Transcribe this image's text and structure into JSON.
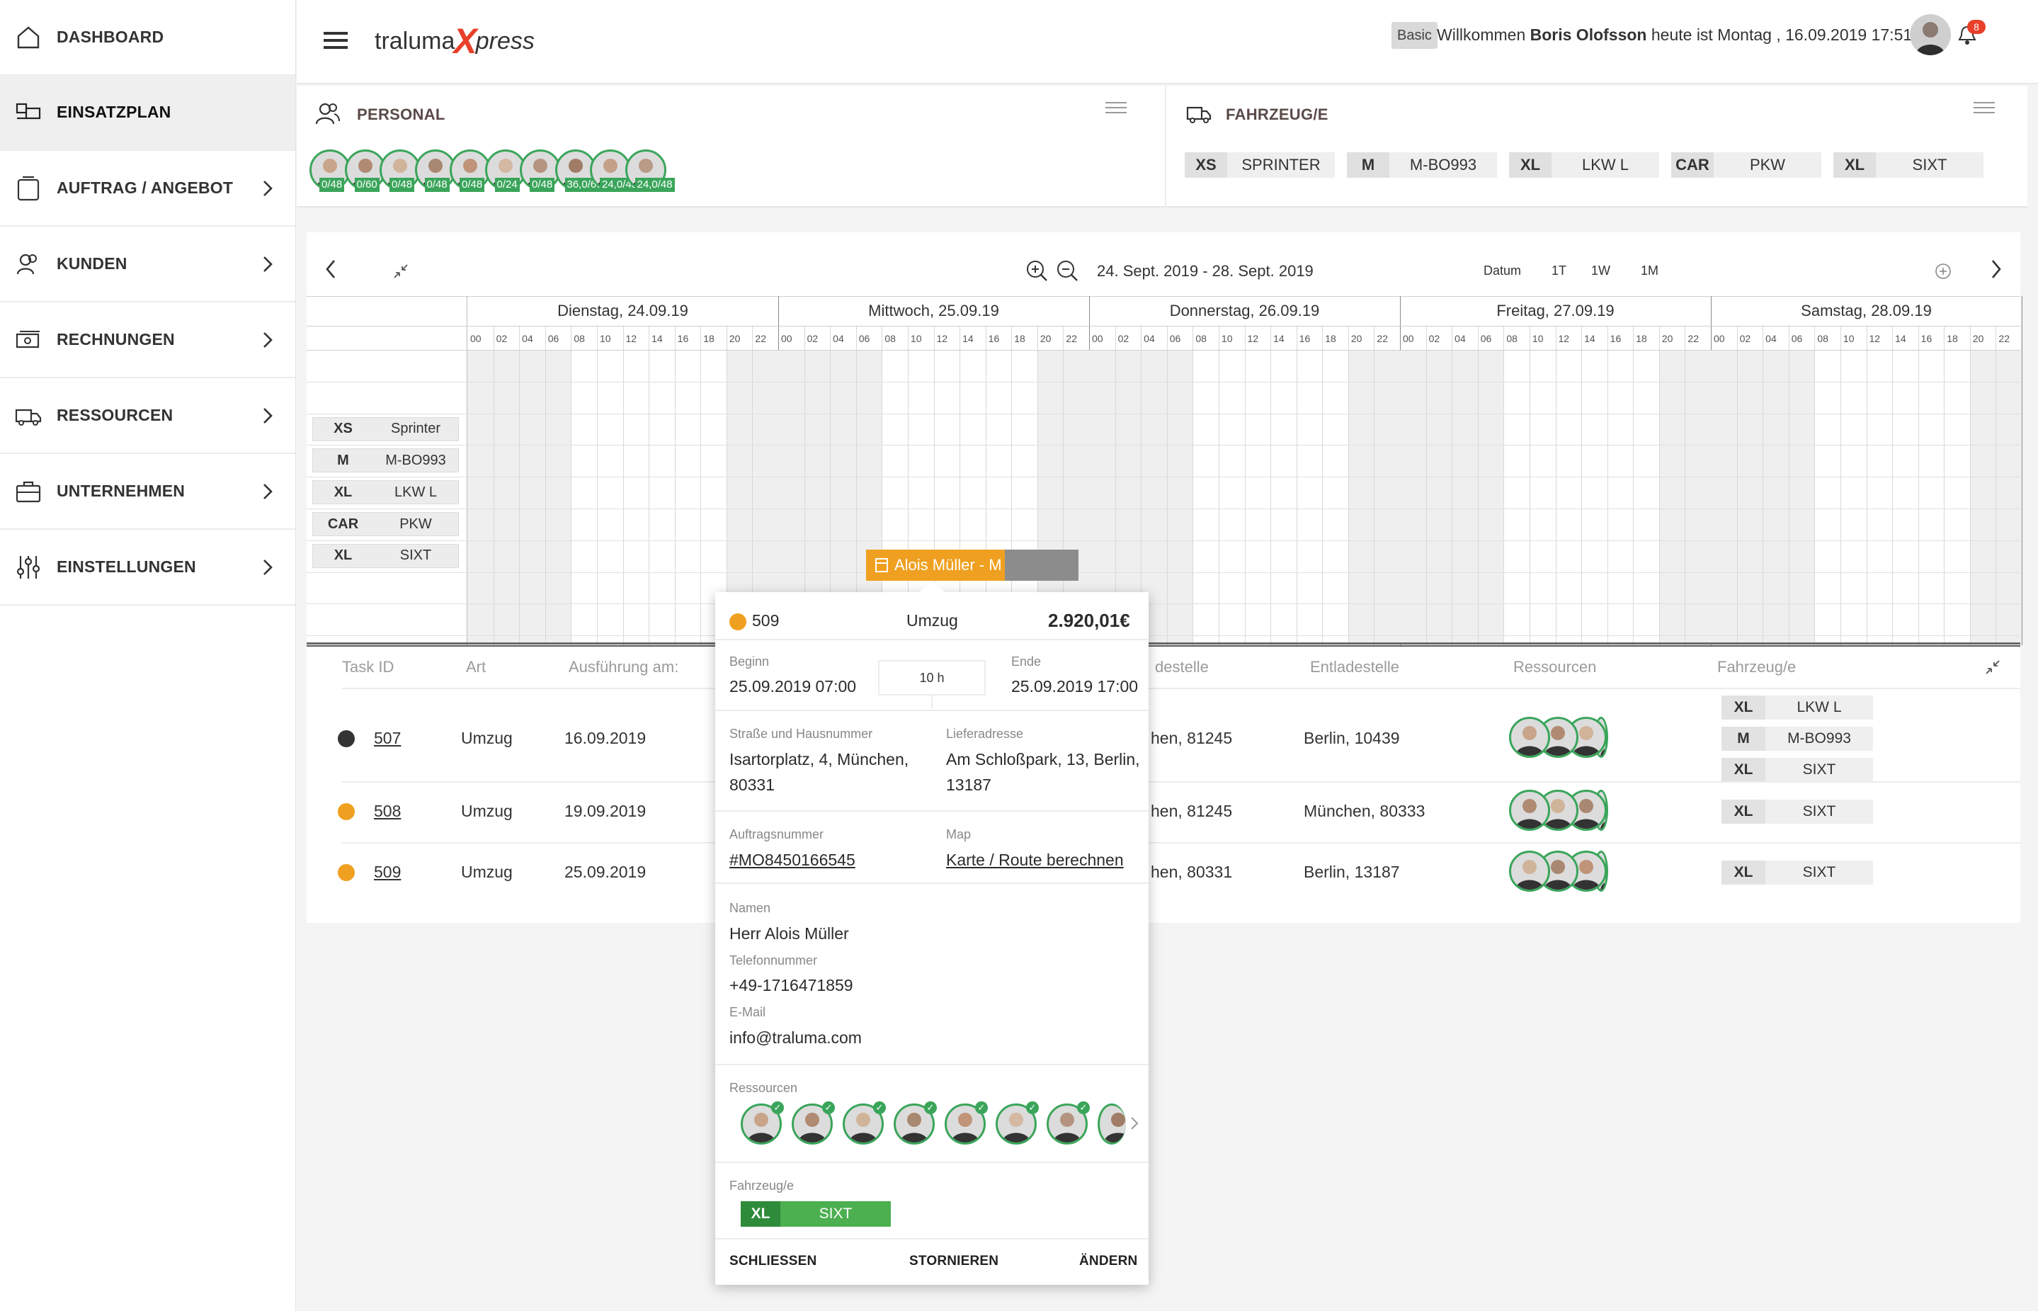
{
  "sidebar": {
    "items": [
      {
        "label": "DASHBOARD",
        "icon": "home-icon"
      },
      {
        "label": "EINSATZPLAN",
        "icon": "schedule-icon"
      },
      {
        "label": "AUFTRAG / ANGEBOT",
        "icon": "order-icon"
      },
      {
        "label": "KUNDEN",
        "icon": "customers-icon"
      },
      {
        "label": "RECHNUNGEN",
        "icon": "invoice-icon"
      },
      {
        "label": "RESSOURCEN",
        "icon": "truck-icon"
      },
      {
        "label": "UNTERNEHMEN",
        "icon": "briefcase-icon"
      },
      {
        "label": "EINSTELLUNGEN",
        "icon": "sliders-icon"
      }
    ]
  },
  "header": {
    "logo_a": "traluma",
    "logo_x": "X",
    "logo_b": "press",
    "plan_badge": "Basic",
    "welcome_pre": "Willkommen ",
    "user_name": "Boris Olofsson",
    "welcome_post": " heute ist Montag , 16.09.2019 17:51",
    "notification_count": "8"
  },
  "personal": {
    "title": "PERSONAL",
    "staff": [
      {
        "badge": "0/48"
      },
      {
        "badge": "0/60"
      },
      {
        "badge": "0/48"
      },
      {
        "badge": "0/48"
      },
      {
        "badge": "0/48"
      },
      {
        "badge": "0/24"
      },
      {
        "badge": "0/48"
      },
      {
        "badge": "36,0/60"
      },
      {
        "badge": "24,0/48"
      },
      {
        "badge": "24,0/48"
      }
    ]
  },
  "fahrzeuge": {
    "title": "FAHRZEUG/E",
    "items": [
      {
        "cls": "XS",
        "name": "SPRINTER"
      },
      {
        "cls": "M",
        "name": "M-BO993"
      },
      {
        "cls": "XL",
        "name": "LKW L"
      },
      {
        "cls": "CAR",
        "name": "PKW"
      },
      {
        "cls": "XL",
        "name": "SIXT"
      }
    ]
  },
  "calendar": {
    "range": "24. Sept. 2019 - 28. Sept. 2019",
    "view_label": "Datum",
    "views": [
      "1T",
      "1W",
      "1M"
    ],
    "days": [
      "Dienstag, 24.09.19",
      "Mittwoch, 25.09.19",
      "Donnerstag, 26.09.19",
      "Freitag, 27.09.19",
      "Samstag, 28.09.19"
    ],
    "hours": [
      "00",
      "02",
      "04",
      "06",
      "08",
      "10",
      "12",
      "14",
      "16",
      "18",
      "20",
      "22"
    ],
    "rows": [
      {
        "cls": "XS",
        "name": "Sprinter"
      },
      {
        "cls": "M",
        "name": "M-BO993"
      },
      {
        "cls": "XL",
        "name": "LKW L"
      },
      {
        "cls": "CAR",
        "name": "PKW"
      },
      {
        "cls": "XL",
        "name": "SIXT"
      }
    ],
    "event_label": "Alois Müller - M",
    "colors": {
      "event": "#f0a020",
      "accent": "#e8402a",
      "green": "#3aa55a"
    }
  },
  "table": {
    "headers": [
      "Task ID",
      "Art",
      "Ausführung am:",
      "destelle",
      "Entladestelle",
      "Ressourcen",
      "Fahrzeug/e"
    ],
    "rows": [
      {
        "status": "#333333",
        "id": "507",
        "art": "Umzug",
        "date": "16.09.2019",
        "from": "hen, 81245",
        "to": "Berlin, 10439",
        "vehicles": [
          {
            "cls": "XL",
            "name": "LKW L"
          },
          {
            "cls": "M",
            "name": "M-BO993"
          },
          {
            "cls": "XL",
            "name": "SIXT"
          }
        ]
      },
      {
        "status": "#f0a020",
        "id": "508",
        "art": "Umzug",
        "date": "19.09.2019",
        "from": "hen, 81245",
        "to": "München, 80333",
        "vehicles": [
          {
            "cls": "XL",
            "name": "SIXT"
          }
        ]
      },
      {
        "status": "#f0a020",
        "id": "509",
        "art": "Umzug",
        "date": "25.09.2019",
        "from": "hen, 80331",
        "to": "Berlin, 13187",
        "vehicles": [
          {
            "cls": "XL",
            "name": "SIXT"
          }
        ]
      }
    ]
  },
  "popup": {
    "id": "509",
    "type": "Umzug",
    "price": "2.920,01€",
    "begin_label": "Beginn",
    "begin": "25.09.2019 07:00",
    "duration": "10 h",
    "end_label": "Ende",
    "end": "25.09.2019 17:00",
    "street_label": "Straße und Hausnummer",
    "street_1": "Isartorplatz, 4, München,",
    "street_2": "80331",
    "delivery_label": "Lieferadresse",
    "delivery_1": "Am Schloßpark, 13, Berlin,",
    "delivery_2": "13187",
    "order_label": "Auftragsnummer",
    "order": "#MO8450166545",
    "map_label": "Map",
    "map": "Karte / Route berechnen",
    "name_label": "Namen",
    "name": "Herr Alois Müller",
    "phone_label": "Telefonnummer",
    "phone": "+49-1716471859",
    "email_label": "E-Mail",
    "email": "info@traluma.com",
    "resources_label": "Ressourcen",
    "vehicle_label": "Fahrzeug/e",
    "vehicle_cls": "XL",
    "vehicle_name": "SIXT",
    "btn_close": "SCHLIESSEN",
    "btn_cancel": "STORNIEREN",
    "btn_change": "ÄNDERN"
  }
}
